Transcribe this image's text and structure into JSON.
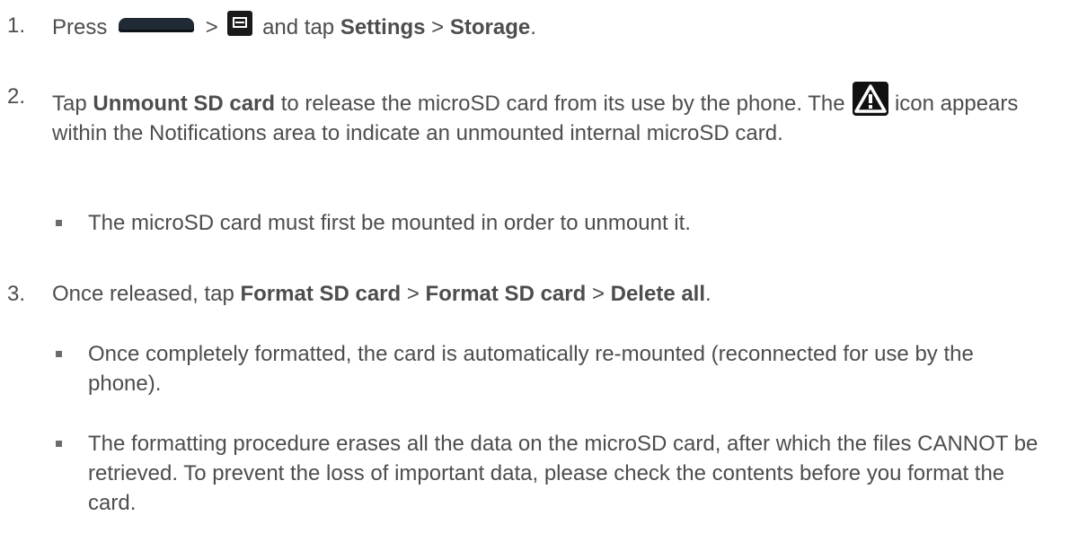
{
  "steps": [
    {
      "number": "1.",
      "t1": "Press",
      "t2": ">",
      "t3": "and tap",
      "b1": "Settings",
      "t4": ">",
      "b2": "Storage",
      "t5": "."
    },
    {
      "number": "2.",
      "t1": "Tap",
      "b1": "Unmount SD card",
      "t2": "to release the microSD card from its use by the phone. The",
      "t3": "icon appears within the Notifications area to indicate an unmounted internal microSD card."
    },
    {
      "number": "3.",
      "t1": "Once released, tap",
      "b1": "Format SD card",
      "t2": ">",
      "b2": "Format SD card",
      "t3": ">",
      "b3": "Delete all",
      "t4": "."
    }
  ],
  "bullets": [
    "The microSD card must first be mounted in order to unmount it.",
    "Once completely formatted, the card is automatically re-mounted (reconnected for use by the phone).",
    "The formatting procedure erases all the data on the microSD card, after which the files CANNOT be retrieved. To prevent the loss of important data, please check the contents before you format the card."
  ],
  "icons": {
    "home_key": "home-key-icon",
    "menu_key": "menu-key-icon",
    "warning": "warning-icon"
  }
}
